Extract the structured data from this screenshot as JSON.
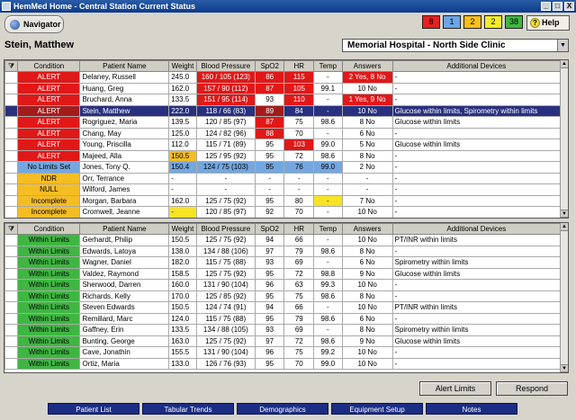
{
  "window": {
    "title": "HemMed Home - Central Station Current Status",
    "controls": [
      "_",
      "□",
      "X"
    ]
  },
  "toolbar": {
    "navigator_label": "Navigator",
    "counts": [
      {
        "value": "8",
        "color": "#e62020"
      },
      {
        "value": "1",
        "color": "#6aa6e6"
      },
      {
        "value": "2",
        "color": "#f6c018"
      },
      {
        "value": "2",
        "color": "#f3ec2a"
      },
      {
        "value": "38",
        "color": "#3fb642"
      }
    ],
    "help_label": "Help"
  },
  "selected_patient": "Stein, Matthew",
  "hospital_select": {
    "value": "Memorial Hospital - North Side Clinic"
  },
  "columns": [
    "Condition",
    "Patient Name",
    "Weight",
    "Blood Pressure",
    "SpO2",
    "HR",
    "Temp",
    "Answers",
    "Additional Devices"
  ],
  "top_rows": [
    {
      "condition": "ALERT",
      "name": "Delaney, Russell",
      "weight": "245.0",
      "bp": "160 / 105 (123)",
      "spo2": "86",
      "hr": "115",
      "temp": "-",
      "answers": "2 Yes, 8 No",
      "devices": "-"
    },
    {
      "condition": "ALERT",
      "name": "Huang, Greg",
      "weight": "162.0",
      "bp": "157 / 90 (112)",
      "spo2": "87",
      "hr": "105",
      "temp": "99.1",
      "answers": "10 No",
      "devices": "-"
    },
    {
      "condition": "ALERT",
      "name": "Bruchard, Anna",
      "weight": "133.5",
      "bp": "151 / 95 (114)",
      "spo2": "93",
      "hr": "110",
      "temp": "-",
      "answers": "1 Yes, 9 No",
      "devices": "-"
    },
    {
      "condition": "ALERT",
      "name": "Stein, Matthew",
      "weight": "222.0",
      "bp": "118 / 66 (83)",
      "spo2": "89",
      "hr": "84",
      "temp": "-",
      "answers": "10 No",
      "devices": "Glucose within limits, Spirometry within limits"
    },
    {
      "condition": "ALERT",
      "name": "Rogriguez, Maria",
      "weight": "139.5",
      "bp": "120 / 85 (97)",
      "spo2": "87",
      "hr": "75",
      "temp": "98.6",
      "answers": "8 No",
      "devices": "Glucose within limits"
    },
    {
      "condition": "ALERT",
      "name": "Chang, May",
      "weight": "125.0",
      "bp": "124 / 82 (96)",
      "spo2": "88",
      "hr": "70",
      "temp": "-",
      "answers": "6 No",
      "devices": "-"
    },
    {
      "condition": "ALERT",
      "name": "Young, Priscilla",
      "weight": "112.0",
      "bp": "115 / 71 (89)",
      "spo2": "95",
      "hr": "103",
      "temp": "99.0",
      "answers": "5 No",
      "devices": "Glucose within limits"
    },
    {
      "condition": "ALERT",
      "name": "Majeed, Alla",
      "weight": "150.5",
      "bp": "125 / 95 (92)",
      "spo2": "95",
      "hr": "72",
      "temp": "98.6",
      "answers": "8 No",
      "devices": "-"
    },
    {
      "condition": "No Limits Set",
      "name": "Jones, Tony Q.",
      "weight": "150.4",
      "bp": "124 / 75 (103)",
      "spo2": "95",
      "hr": "76",
      "temp": "99.0",
      "answers": "2 No",
      "devices": "-"
    },
    {
      "condition": "NDR",
      "name": "Orr, Terrance",
      "weight": "-",
      "bp": "-",
      "spo2": "-",
      "hr": "-",
      "temp": "-",
      "answers": "-",
      "devices": "-"
    },
    {
      "condition": "NULL",
      "name": "Wilford, James",
      "weight": "-",
      "bp": "-",
      "spo2": "-",
      "hr": "-",
      "temp": "-",
      "answers": "-",
      "devices": "-"
    },
    {
      "condition": "Incomplete",
      "name": "Morgan, Barbara",
      "weight": "162.0",
      "bp": "125 / 75 (92)",
      "spo2": "95",
      "hr": "80",
      "temp": "-",
      "answers": "7 No",
      "devices": "-"
    },
    {
      "condition": "Incomplete",
      "name": "Cromwell, Jeanne",
      "weight": "-",
      "bp": "120 / 85 (97)",
      "spo2": "92",
      "hr": "70",
      "temp": "-",
      "answers": "10 No",
      "devices": "-"
    }
  ],
  "bottom_rows": [
    {
      "condition": "Within Limits",
      "name": "Gerhardt, Philip",
      "weight": "150.5",
      "bp": "125 / 75 (92)",
      "spo2": "94",
      "hr": "66",
      "temp": "-",
      "answers": "10 No",
      "devices": "PT/INR within limits"
    },
    {
      "condition": "Within Limits",
      "name": "Edwards, Latoya",
      "weight": "138.0",
      "bp": "134 / 88 (106)",
      "spo2": "97",
      "hr": "79",
      "temp": "98.6",
      "answers": "8 No",
      "devices": "-"
    },
    {
      "condition": "Within Limits",
      "name": "Wagner, Daniel",
      "weight": "182.0",
      "bp": "115 / 75 (88)",
      "spo2": "93",
      "hr": "69",
      "temp": "-",
      "answers": "6 No",
      "devices": "Spirometry within limits"
    },
    {
      "condition": "Within Limits",
      "name": "Valdez, Raymond",
      "weight": "158.5",
      "bp": "125 / 75 (92)",
      "spo2": "95",
      "hr": "72",
      "temp": "98.8",
      "answers": "9 No",
      "devices": "Glucose within limits"
    },
    {
      "condition": "Within Limits",
      "name": "Sherwood, Darren",
      "weight": "160.0",
      "bp": "131 / 90 (104)",
      "spo2": "96",
      "hr": "63",
      "temp": "99.3",
      "answers": "10 No",
      "devices": "-"
    },
    {
      "condition": "Within Limits",
      "name": "Richards, Kelly",
      "weight": "170.0",
      "bp": "125 / 85 (92)",
      "spo2": "95",
      "hr": "75",
      "temp": "98.6",
      "answers": "8 No",
      "devices": "-"
    },
    {
      "condition": "Within Limits",
      "name": "Steven Edwards",
      "weight": "150.5",
      "bp": "124 / 74 (91)",
      "spo2": "94",
      "hr": "66",
      "temp": "-",
      "answers": "10 No",
      "devices": "PT/INR within limits"
    },
    {
      "condition": "Within Limits",
      "name": "Remillard, Marc",
      "weight": "124.0",
      "bp": "115 / 75 (88)",
      "spo2": "95",
      "hr": "79",
      "temp": "98.6",
      "answers": "6 No",
      "devices": "-"
    },
    {
      "condition": "Within Limits",
      "name": "Gaffney, Erin",
      "weight": "133.5",
      "bp": "134 / 88 (105)",
      "spo2": "93",
      "hr": "69",
      "temp": "-",
      "answers": "8 No",
      "devices": "Spirometry within limits"
    },
    {
      "condition": "Within Limits",
      "name": "Bunting, George",
      "weight": "163.0",
      "bp": "125 / 75 (92)",
      "spo2": "97",
      "hr": "72",
      "temp": "98.6",
      "answers": "9 No",
      "devices": "Glucose within limits"
    },
    {
      "condition": "Within Limits",
      "name": "Cave, Jonathin",
      "weight": "155.5",
      "bp": "131 / 90 (104)",
      "spo2": "96",
      "hr": "75",
      "temp": "99.2",
      "answers": "10 No",
      "devices": "-"
    },
    {
      "condition": "Within Limits",
      "name": "Ortiz, Maria",
      "weight": "133.0",
      "bp": "126 / 76 (93)",
      "spo2": "95",
      "hr": "70",
      "temp": "99.0",
      "answers": "10 No",
      "devices": "-"
    }
  ],
  "buttons": {
    "alert_limits": "Alert Limits",
    "respond": "Respond"
  },
  "bottom_tabs": [
    "Patient List",
    "Tabular Trends",
    "Demographics",
    "Equipment Setup",
    "Notes"
  ]
}
